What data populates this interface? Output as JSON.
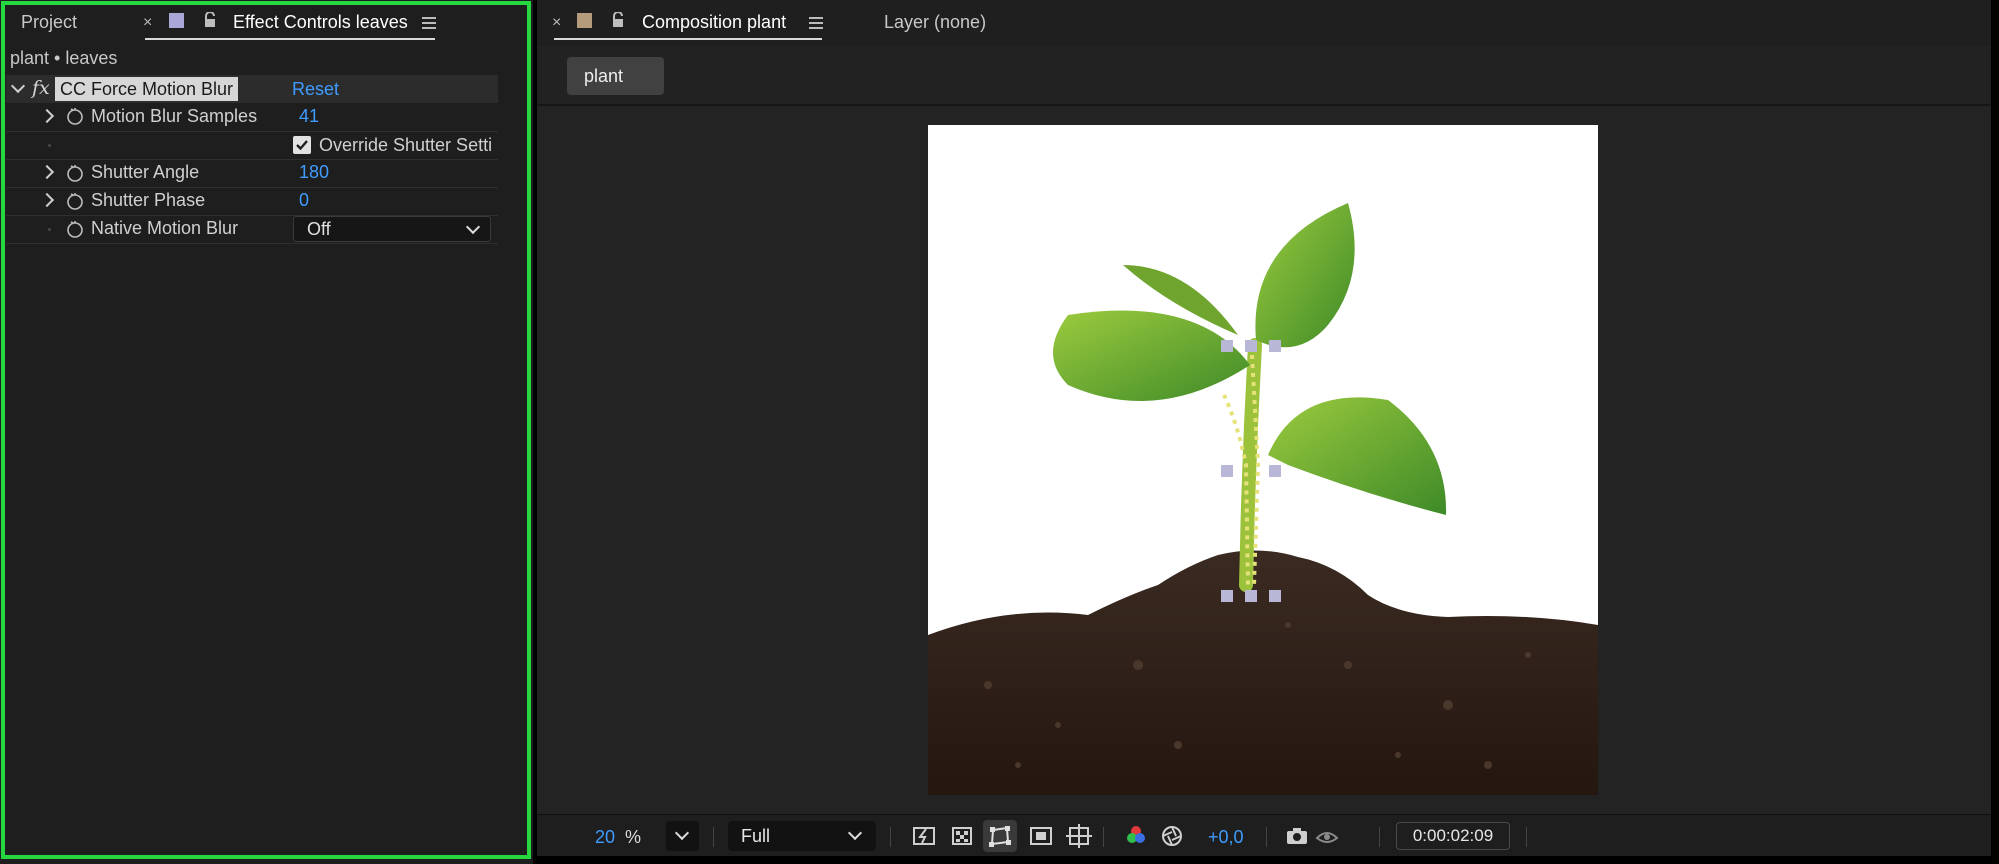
{
  "left_panel": {
    "tabs": {
      "project": "Project",
      "effect_controls": "Effect Controls leaves"
    },
    "breadcrumb": "plant • leaves",
    "effect": {
      "name": "CC Force Motion Blur",
      "reset": "Reset"
    },
    "properties": [
      {
        "label": "Motion Blur Samples",
        "value": "41"
      },
      {
        "label": "Override Shutter Setti"
      },
      {
        "label": "Shutter Angle",
        "value": "180"
      },
      {
        "label": "Shutter Phase",
        "value": "0"
      },
      {
        "label": "Native Motion Blur",
        "value": "Off"
      }
    ]
  },
  "right_panel": {
    "tabs": {
      "composition": "Composition plant",
      "layer": "Layer (none)"
    },
    "comp_chip": "plant",
    "toolbar": {
      "zoom_value": "20",
      "zoom_unit": "%",
      "resolution": "Full",
      "exposure": "+0,0",
      "timecode": "0:00:02:09"
    }
  },
  "colors": {
    "highlight_border": "#25d840",
    "value_blue": "#3f9cff",
    "panel_bg": "#1e1e1e"
  },
  "icons": [
    "close-icon",
    "label-swatch-icon",
    "lock-icon",
    "panel-menu-icon",
    "fx-icon",
    "stopwatch-icon",
    "checkbox-icon",
    "chevron-down-icon"
  ]
}
